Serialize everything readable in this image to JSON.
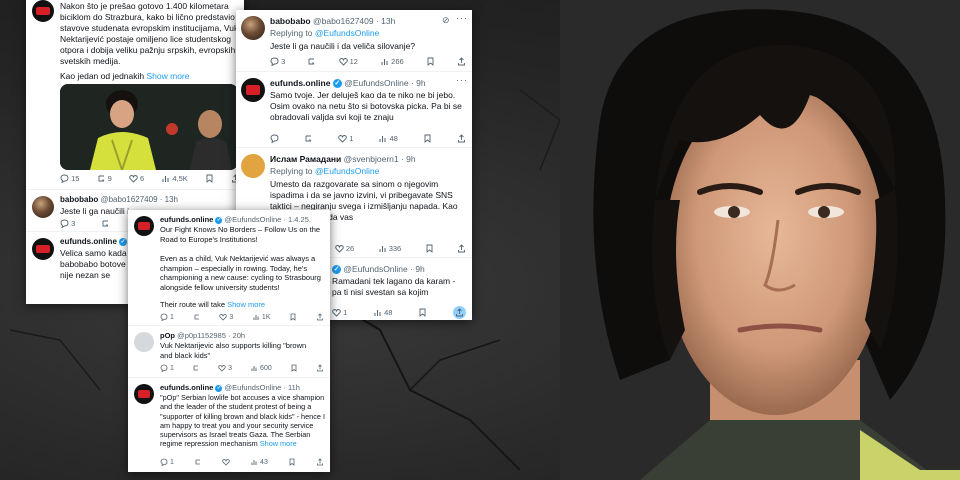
{
  "card1": {
    "tweet_top": {
      "text": "Nakon što je prešao gotovo 1.400 kilometara biciklom do Strazbura, kako bi lično predstavio stavove studenata evropskim institucijama, Vuk Nektarijević postaje omiljeno lice studentskog otpora i dobija veliku pažnju srpskih, evropskih i svetskih medija.",
      "text2": "Kao jedan od jednakih",
      "show_more": "Show more",
      "stats": {
        "replies": "15",
        "retweets": "9",
        "likes": "6",
        "views": "4,5K"
      }
    },
    "tweet_reply1": {
      "name": "babobabo",
      "handle": "@babo1627409 · 13h",
      "text": "Jeste li ga naučili i",
      "stats": {
        "replies": "3",
        "likes": "1"
      }
    },
    "tweet_reply2": {
      "name": "eufunds.online",
      "text": "Velica samo kada u babobabo botove onda nije nezan se"
    }
  },
  "card2": {
    "t1": {
      "name": "babobabo",
      "handle": "@babo1627409 · 13h",
      "replying": "Replying to",
      "replying_to": "@EufundsOnline",
      "text": "Jeste li ga naučili i da veliča silovanje?",
      "stats": {
        "replies": "3",
        "likes": "12",
        "views": "266"
      }
    },
    "t2": {
      "name": "eufunds.online",
      "handle": "@EufundsOnline · 9h",
      "text": "Samo tvoje. Jer deluješ kao da te niko ne bi jebo. Osim ovako na netu što si botovska picka. Pa bi se obradovali valjda svi koji te znaju",
      "stats": {
        "likes": "1",
        "views": "48"
      }
    },
    "t3": {
      "name": "Ислам Рамадани",
      "handle": "@svenbjoern1 · 9h",
      "replying": "Replying to",
      "replying_to": "@EufundsOnline",
      "text": "Umesto da razgovarate sa sinom o njegovim ispadima i da se javno izvini, vi pribegavate SNS taktici – negiranju svega i izmišljanju napada. Kao otac, trebalo bi da vas",
      "stats": {
        "likes": "26",
        "views": "336"
      }
    },
    "t4": {
      "handle": "@EufundsOnline · 9h",
      "text": "Ramadani tek lagano da karam - pa ti nisi svestan sa kojim",
      "stats": {
        "likes": "1",
        "views": "48"
      }
    }
  },
  "card3": {
    "t1": {
      "name": "eufunds.online",
      "handle": "@EufundsOnline · 1.4.25.",
      "text": "Our Fight Knows No Borders – Follow Us on the Road to Europe's Institutions!",
      "text2": "Even as a child, Vuk Nektarijević was always a champion – especially in rowing. Today, he's championing a new cause: cycling to Strasbourg alongside fellow university students!",
      "text3": "Their route will take",
      "show_more": "Show more",
      "stats": {
        "replies": "1",
        "likes": "3",
        "views": "1K"
      }
    },
    "t2": {
      "name": "pOp",
      "handle": "@p0p1152985 · 20h",
      "text": "Vuk Nektarijevic also supports killing \"brown and black kids\"",
      "stats": {
        "replies": "1",
        "likes": "3",
        "views": "600"
      }
    },
    "t3": {
      "name": "eufunds.online",
      "handle": "@EufundsOnline · 11h",
      "text": "\"pOp\" Serbian lowlife bot accuses a vice shampion and the leader of the student protest of being a \"supporter of killing brown and black kids\" - hence I am happy to treat you and your security service supervisors as Israel treats Gaza. The Serbian regime repression mechanism",
      "show_more": "Show more",
      "stats": {
        "replies": "1",
        "views": "43"
      }
    }
  },
  "icons": [
    "reply-icon",
    "retweet-icon",
    "like-icon",
    "views-icon",
    "bookmark-icon",
    "share-icon",
    "verified-icon",
    "grok-icon",
    "more-icon"
  ],
  "colors": {
    "link": "#1d9bf0",
    "text": "#0f1419",
    "muted": "#536471"
  }
}
